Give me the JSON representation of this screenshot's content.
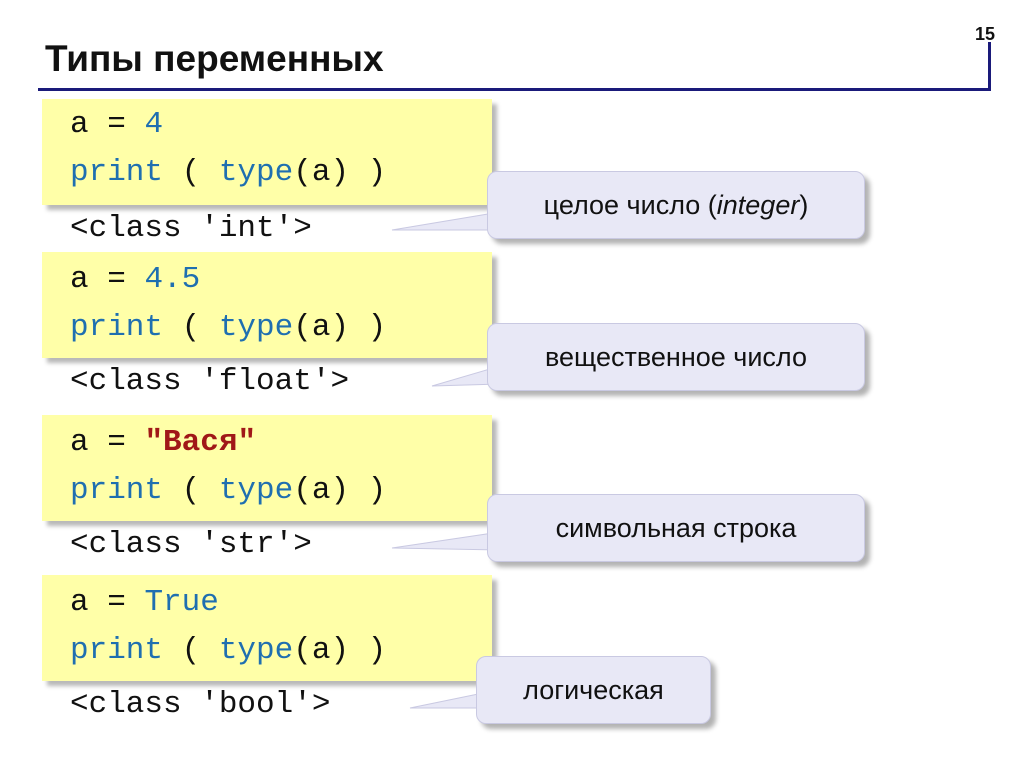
{
  "slide_number": "15",
  "title": "Типы переменных",
  "examples": [
    {
      "assign_var": "a",
      "assign_eq": "=",
      "assign_value": "4",
      "print_kw": "print",
      "print_open": " ( ",
      "type_kw": "type",
      "type_arg": "(a)",
      "print_close": " )",
      "output": "<class 'int'>",
      "callout_text": "целое число (",
      "callout_italic": "integer",
      "callout_close": ")"
    },
    {
      "assign_var": "a",
      "assign_eq": "=",
      "assign_value": "4.5",
      "print_kw": "print",
      "print_open": " ( ",
      "type_kw": "type",
      "type_arg": "(a)",
      "print_close": " )",
      "output": "<class 'float'>",
      "callout_text": "вещественное число"
    },
    {
      "assign_var": "a",
      "assign_eq": "=",
      "assign_value": "\"Вася\"",
      "print_kw": "print",
      "print_open": " ( ",
      "type_kw": "type",
      "type_arg": "(a)",
      "print_close": " )",
      "output": "<class 'str'>",
      "callout_text": "символьная строка"
    },
    {
      "assign_var": "a",
      "assign_eq": "=",
      "assign_value": "True",
      "print_kw": "print",
      "print_open": " ( ",
      "type_kw": "type",
      "type_arg": "(a)",
      "print_close": " )",
      "output": "<class 'bool'>",
      "callout_text": "логическая"
    }
  ]
}
